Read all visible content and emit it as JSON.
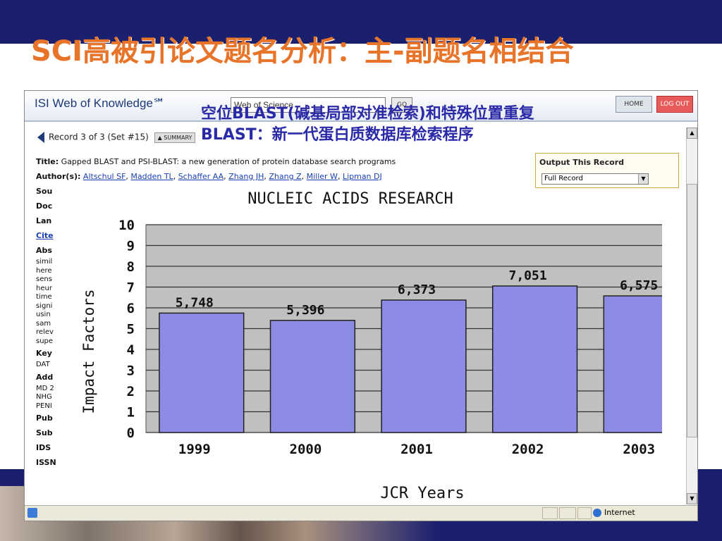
{
  "slide": {
    "title": "SCI高被引论文题名分析：主-副题名相结合"
  },
  "browser": {
    "logo": "ISI Web of Knowledge℠",
    "database_select": "Web of Science",
    "go_label": "GO",
    "home_label": "HOME",
    "logout_label": "LOG OUT",
    "overlay_line1": "空位BLAST(碱基局部对准检索)和特殊位置重复",
    "overlay_line2": "BLAST：新一代蛋白质数据库检索程序",
    "record_nav": "Record 3 of 3 (Set #15)",
    "summary_label": "▲ SUMMARY",
    "title_label": "Title:",
    "title_value": "Gapped BLAST and PSI-BLAST: a new generation of protein database search programs",
    "author_label": "Author(s):",
    "authors": [
      "Altschul SF",
      "Madden TL",
      "Schaffer AA",
      "Zhang JH",
      "Zhang Z",
      "Miller W",
      "Lipman DJ"
    ],
    "left_labels": [
      "Sou",
      "Doc",
      "Lan",
      "Cite",
      "Abs"
    ],
    "abstract_fragments": [
      "simil",
      "here",
      "sens",
      "heur",
      "time",
      "signi",
      "usin",
      "sam",
      "relev",
      "supe"
    ],
    "more_labels": [
      "Key",
      "DAT",
      "Add",
      "MD 2",
      "NHG",
      "PENI",
      "Pub",
      "Sub",
      "IDS",
      "ISSN"
    ],
    "output_title": "Output This Record",
    "output_select": "Full Record",
    "status_zone": "Internet",
    "scroll_up": "▲",
    "scroll_down": "▼",
    "select_arrow": "▼"
  },
  "chart_data": {
    "type": "bar",
    "title": "NUCLEIC ACIDS RESEARCH",
    "xlabel": "JCR Years",
    "ylabel": "Impact Factors",
    "categories": [
      "1999",
      "2000",
      "2001",
      "2002",
      "2003"
    ],
    "values": [
      5.748,
      5.396,
      6.373,
      7.051,
      6.575
    ],
    "value_labels": [
      "5,748",
      "5,396",
      "6,373",
      "7,051",
      "6,575"
    ],
    "ylim": [
      0,
      10
    ],
    "yticks": [
      0,
      1,
      2,
      3,
      4,
      5,
      6,
      7,
      8,
      9,
      10
    ],
    "grid": true,
    "bar_color": "#8c8ce6",
    "plot_bg": "#c0c0c0"
  },
  "colors": {
    "title_orange": "#e8742a",
    "band_navy": "#1a1f6e",
    "overlay_blue": "#2a2aa8"
  }
}
